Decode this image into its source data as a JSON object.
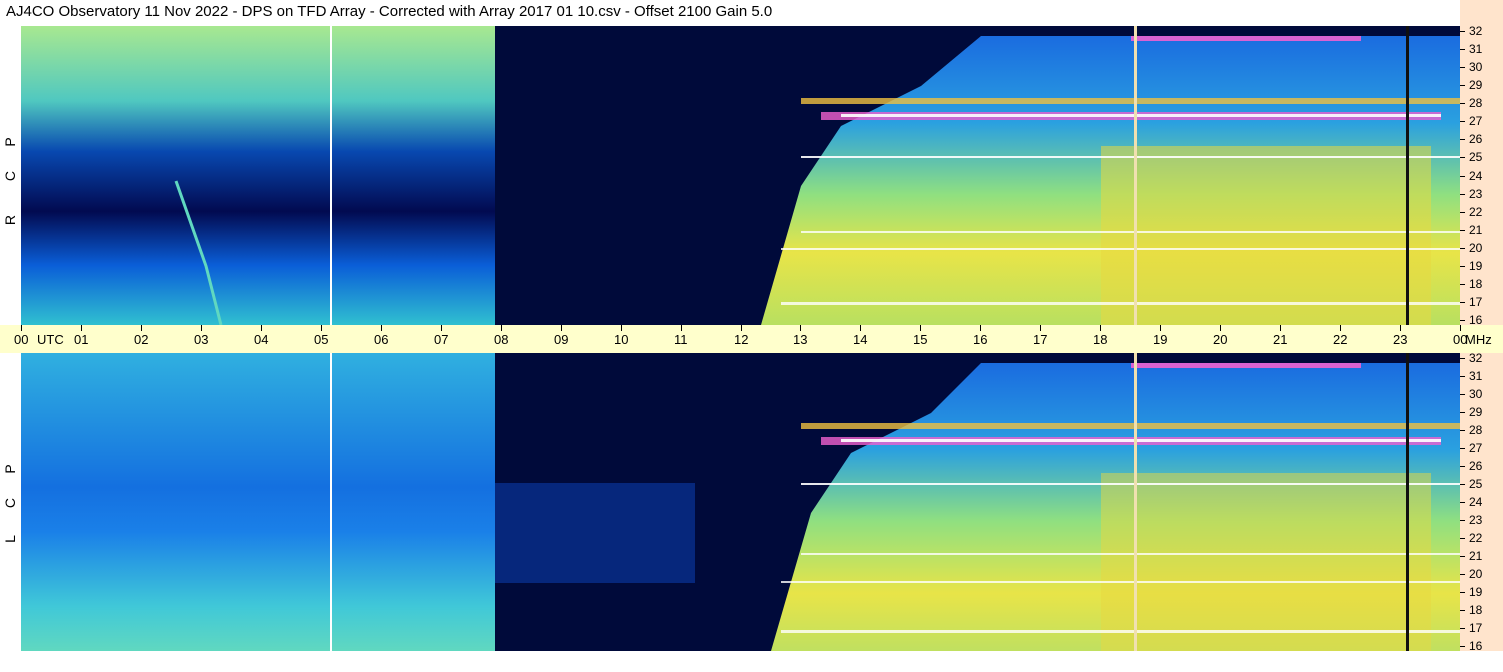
{
  "title": "AJ4CO Observatory  11 Nov 2022  -  DPS on TFD Array  -  Corrected with Array 2017 01 10.csv  -  Offset 2100  Gain 5.0",
  "panels": {
    "top": {
      "label_letters": [
        "R",
        "C",
        "P"
      ]
    },
    "bottom": {
      "label_letters": [
        "L",
        "C",
        "P"
      ]
    }
  },
  "time_axis": {
    "labels": [
      "00",
      "UTC",
      "01",
      "02",
      "03",
      "04",
      "05",
      "06",
      "07",
      "08",
      "09",
      "10",
      "11",
      "12",
      "13",
      "14",
      "15",
      "16",
      "17",
      "18",
      "19",
      "20",
      "21",
      "22",
      "23",
      "00",
      "MHz"
    ]
  },
  "freq_axis": {
    "labels": [
      "32",
      "31",
      "30",
      "29",
      "28",
      "27",
      "26",
      "25",
      "24",
      "23",
      "22",
      "21",
      "20",
      "19",
      "18",
      "17",
      "16"
    ]
  },
  "colors": {
    "time_axis_bg": "#ffffcc",
    "freq_axis_bg": "#ffe4cc",
    "spectrogram_dark": "#000a3a",
    "spectrogram_blue": "#0050d8",
    "spectrogram_cyan": "#20b8e0",
    "spectrogram_green": "#7ee07a",
    "spectrogram_yellow": "#f0e040",
    "spectrogram_magenta": "#e03cc8"
  }
}
